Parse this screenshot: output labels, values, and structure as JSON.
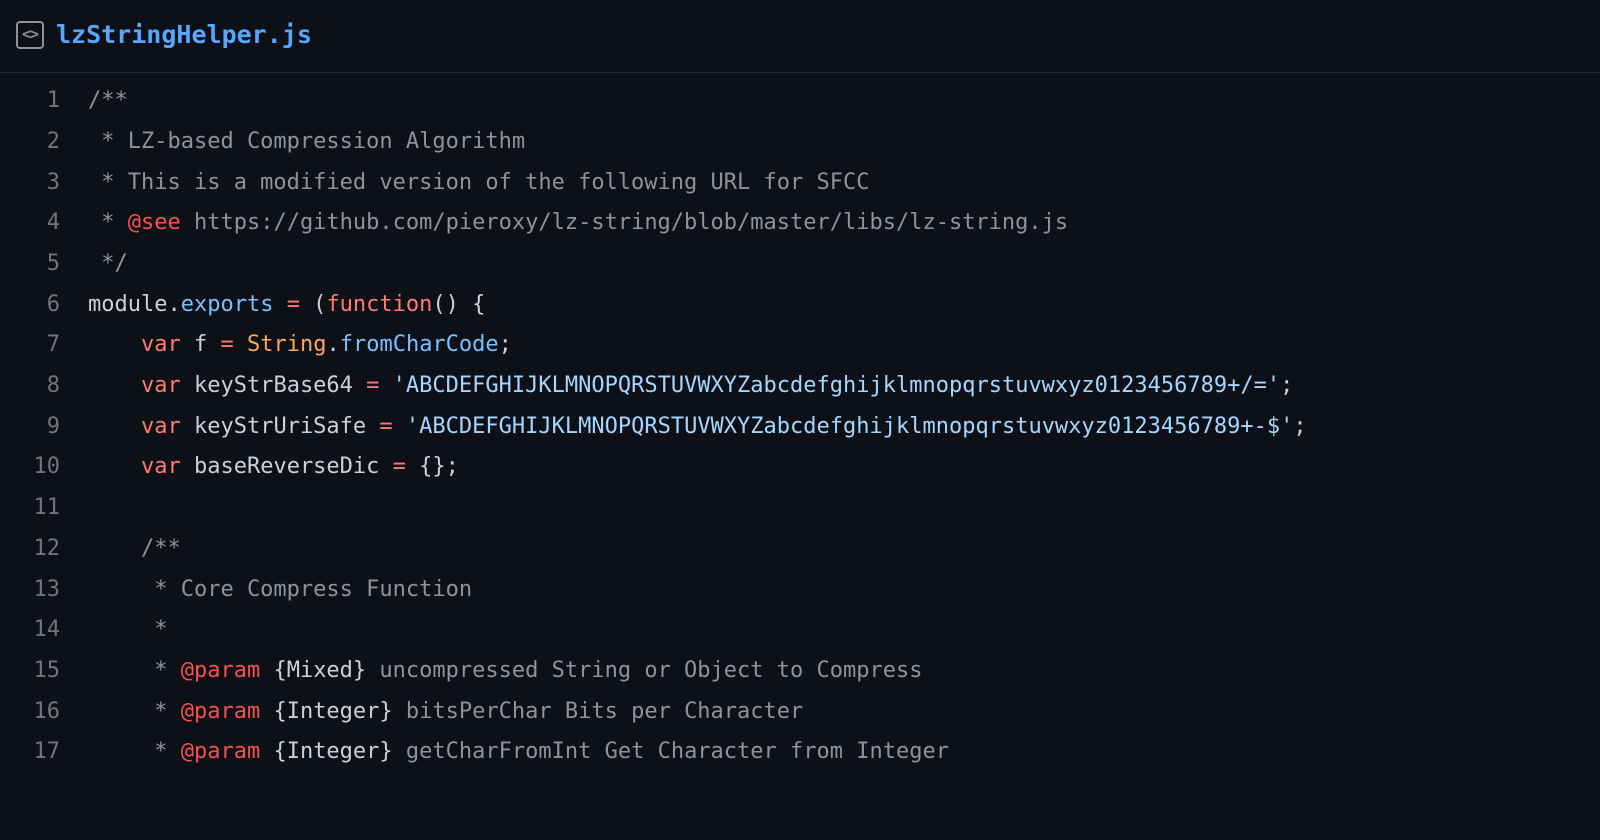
{
  "header": {
    "filename": "lzStringHelper.js",
    "icon_glyph": "<>"
  },
  "colors": {
    "background": "#0d1117",
    "gutter": "#6e7681",
    "comment": "#8b949e",
    "tag": "#f85149",
    "keyword": "#ff7b72",
    "property": "#79c0ff",
    "function": "#d2a8ff",
    "class": "#ffa657",
    "string": "#a5d6ff",
    "default": "#c9d1d9",
    "link": "#58a6ff"
  },
  "lines": [
    {
      "n": "1",
      "tokens": [
        {
          "cls": "c-comment",
          "t": "/**"
        }
      ]
    },
    {
      "n": "2",
      "tokens": [
        {
          "cls": "c-comment",
          "t": " * LZ-based Compression Algorithm"
        }
      ]
    },
    {
      "n": "3",
      "tokens": [
        {
          "cls": "c-comment",
          "t": " * This is a modified version of the following URL for SFCC"
        }
      ]
    },
    {
      "n": "4",
      "tokens": [
        {
          "cls": "c-comment",
          "t": " * "
        },
        {
          "cls": "c-tag",
          "t": "@see"
        },
        {
          "cls": "c-comment",
          "t": " https://github.com/pieroxy/lz-string/blob/master/libs/lz-string.js"
        }
      ]
    },
    {
      "n": "5",
      "tokens": [
        {
          "cls": "c-comment",
          "t": " */"
        }
      ]
    },
    {
      "n": "6",
      "tokens": [
        {
          "cls": "c-default",
          "t": "module."
        },
        {
          "cls": "c-prop",
          "t": "exports"
        },
        {
          "cls": "c-default",
          "t": " "
        },
        {
          "cls": "c-keyword",
          "t": "="
        },
        {
          "cls": "c-default",
          "t": " ("
        },
        {
          "cls": "c-keyword",
          "t": "function"
        },
        {
          "cls": "c-default",
          "t": "() {"
        }
      ]
    },
    {
      "n": "7",
      "tokens": [
        {
          "cls": "c-default",
          "t": "    "
        },
        {
          "cls": "c-keyword",
          "t": "var"
        },
        {
          "cls": "c-default",
          "t": " f "
        },
        {
          "cls": "c-keyword",
          "t": "="
        },
        {
          "cls": "c-default",
          "t": " "
        },
        {
          "cls": "c-class",
          "t": "String"
        },
        {
          "cls": "c-default",
          "t": "."
        },
        {
          "cls": "c-prop",
          "t": "fromCharCode"
        },
        {
          "cls": "c-default",
          "t": ";"
        }
      ]
    },
    {
      "n": "8",
      "tokens": [
        {
          "cls": "c-default",
          "t": "    "
        },
        {
          "cls": "c-keyword",
          "t": "var"
        },
        {
          "cls": "c-default",
          "t": " keyStrBase64 "
        },
        {
          "cls": "c-keyword",
          "t": "="
        },
        {
          "cls": "c-default",
          "t": " "
        },
        {
          "cls": "c-string",
          "t": "'ABCDEFGHIJKLMNOPQRSTUVWXYZabcdefghijklmnopqrstuvwxyz0123456789+/='"
        },
        {
          "cls": "c-default",
          "t": ";"
        }
      ]
    },
    {
      "n": "9",
      "tokens": [
        {
          "cls": "c-default",
          "t": "    "
        },
        {
          "cls": "c-keyword",
          "t": "var"
        },
        {
          "cls": "c-default",
          "t": " keyStrUriSafe "
        },
        {
          "cls": "c-keyword",
          "t": "="
        },
        {
          "cls": "c-default",
          "t": " "
        },
        {
          "cls": "c-string",
          "t": "'ABCDEFGHIJKLMNOPQRSTUVWXYZabcdefghijklmnopqrstuvwxyz0123456789+-$'"
        },
        {
          "cls": "c-default",
          "t": ";"
        }
      ]
    },
    {
      "n": "10",
      "tokens": [
        {
          "cls": "c-default",
          "t": "    "
        },
        {
          "cls": "c-keyword",
          "t": "var"
        },
        {
          "cls": "c-default",
          "t": " baseReverseDic "
        },
        {
          "cls": "c-keyword",
          "t": "="
        },
        {
          "cls": "c-default",
          "t": " {};"
        }
      ]
    },
    {
      "n": "11",
      "tokens": [
        {
          "cls": "c-default",
          "t": ""
        }
      ]
    },
    {
      "n": "12",
      "tokens": [
        {
          "cls": "c-comment",
          "t": "    /**"
        }
      ]
    },
    {
      "n": "13",
      "tokens": [
        {
          "cls": "c-comment",
          "t": "     * Core Compress Function"
        }
      ]
    },
    {
      "n": "14",
      "tokens": [
        {
          "cls": "c-comment",
          "t": "     *"
        }
      ]
    },
    {
      "n": "15",
      "tokens": [
        {
          "cls": "c-comment",
          "t": "     * "
        },
        {
          "cls": "c-tag",
          "t": "@param"
        },
        {
          "cls": "c-comment",
          "t": " "
        },
        {
          "cls": "c-default",
          "t": "{Mixed}"
        },
        {
          "cls": "c-comment",
          "t": " uncompressed String or Object to Compress"
        }
      ]
    },
    {
      "n": "16",
      "tokens": [
        {
          "cls": "c-comment",
          "t": "     * "
        },
        {
          "cls": "c-tag",
          "t": "@param"
        },
        {
          "cls": "c-comment",
          "t": " "
        },
        {
          "cls": "c-default",
          "t": "{Integer}"
        },
        {
          "cls": "c-comment",
          "t": " bitsPerChar Bits per Character"
        }
      ]
    },
    {
      "n": "17",
      "tokens": [
        {
          "cls": "c-comment",
          "t": "     * "
        },
        {
          "cls": "c-tag",
          "t": "@param"
        },
        {
          "cls": "c-comment",
          "t": " "
        },
        {
          "cls": "c-default",
          "t": "{Integer}"
        },
        {
          "cls": "c-comment",
          "t": " getCharFromInt Get Character from Integer"
        }
      ]
    }
  ]
}
